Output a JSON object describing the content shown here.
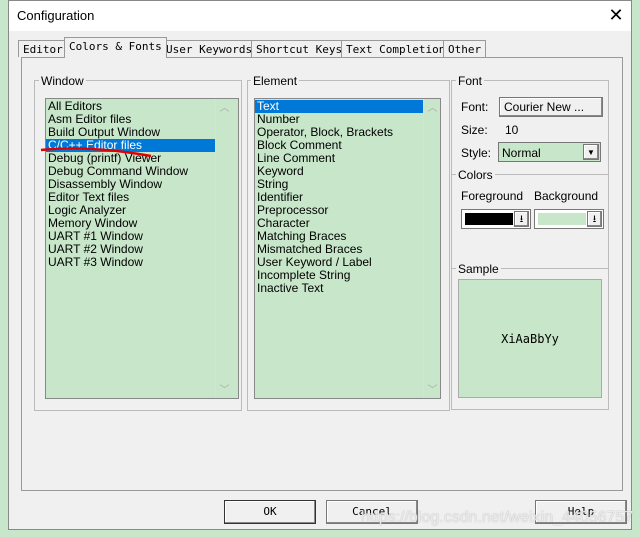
{
  "window": {
    "title": "Configuration",
    "close_glyph": "✕"
  },
  "tabs": [
    {
      "label": "Editor"
    },
    {
      "label": "Colors & Fonts",
      "active": true
    },
    {
      "label": "User Keywords"
    },
    {
      "label": "Shortcut Keys"
    },
    {
      "label": "Text Completion"
    },
    {
      "label": "Other"
    }
  ],
  "window_group": {
    "label": "Window",
    "selected": "C/C++ Editor files",
    "items": [
      "All Editors",
      "Asm Editor files",
      "Build Output Window",
      "C/C++ Editor files",
      "Debug (printf) Viewer",
      "Debug Command Window",
      "Disassembly Window",
      "Editor Text files",
      "Logic Analyzer",
      "Memory Window",
      "UART #1 Window",
      "UART #2 Window",
      "UART #3 Window"
    ]
  },
  "element_group": {
    "label": "Element",
    "selected": "Text",
    "items": [
      "Text",
      "Number",
      "Operator, Block, Brackets",
      "Block Comment",
      "Line Comment",
      "Keyword",
      "String",
      "Identifier",
      "Preprocessor",
      "Character",
      "Matching Braces",
      "Mismatched Braces",
      "User Keyword / Label",
      "Incomplete String",
      "Inactive Text"
    ]
  },
  "font": {
    "label": "Font",
    "font_label": "Font:",
    "font_button": "Courier New ...",
    "size_label": "Size:",
    "size_value": "10",
    "style_label": "Style:",
    "style_value": "Normal"
  },
  "colors": {
    "label": "Colors",
    "foreground_label": "Foreground",
    "background_label": "Background",
    "foreground": "#000000",
    "background": "#c8e6c9"
  },
  "sample": {
    "label": "Sample",
    "text": "XiAaBbYy"
  },
  "buttons": {
    "ok": "OK",
    "cancel": "Cancel",
    "help": "Help"
  },
  "watermark": "https://blog.csdn.net/weixin_44056757",
  "annotation_color": "#e00000"
}
